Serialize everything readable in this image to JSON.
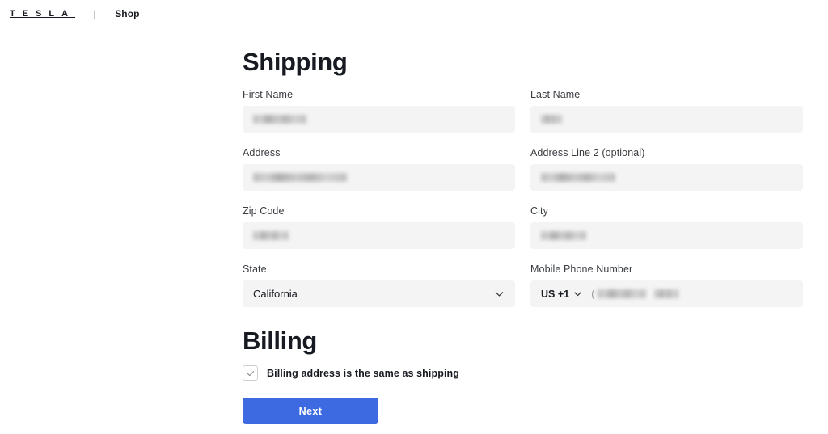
{
  "header": {
    "brand": "TESLA",
    "brand_letters": [
      "T",
      "E",
      "S",
      "L",
      "A"
    ],
    "divider": "|",
    "shop_label": "Shop"
  },
  "colors": {
    "accent_blue": "#3e6ae1",
    "text_dark": "#171a20",
    "label_grey": "#393c41",
    "input_background": "#f4f4f4",
    "page_background": "#ffffff"
  },
  "shipping": {
    "title": "Shipping",
    "fields": {
      "first_name": {
        "label": "First Name",
        "value": "",
        "redacted": true
      },
      "last_name": {
        "label": "Last Name",
        "value": "",
        "redacted": true
      },
      "address": {
        "label": "Address",
        "value": "",
        "redacted": true
      },
      "address_line_2": {
        "label": "Address Line 2 (optional)",
        "value": "",
        "redacted": true
      },
      "zip_code": {
        "label": "Zip Code",
        "value": "",
        "redacted": true
      },
      "city": {
        "label": "City",
        "value": "",
        "redacted": true
      },
      "state": {
        "label": "State",
        "value": "California",
        "icon": "chevron-down-icon"
      },
      "mobile_phone": {
        "label": "Mobile Phone Number",
        "country_code": "US +1",
        "country_icon": "chevron-down-icon",
        "value_prefix": "(",
        "value": "",
        "redacted": true
      }
    }
  },
  "billing": {
    "title": "Billing",
    "same_as_shipping": {
      "label": "Billing address is the same as shipping",
      "checked": true,
      "icon": "checkmark-icon"
    }
  },
  "actions": {
    "next_label": "Next"
  }
}
